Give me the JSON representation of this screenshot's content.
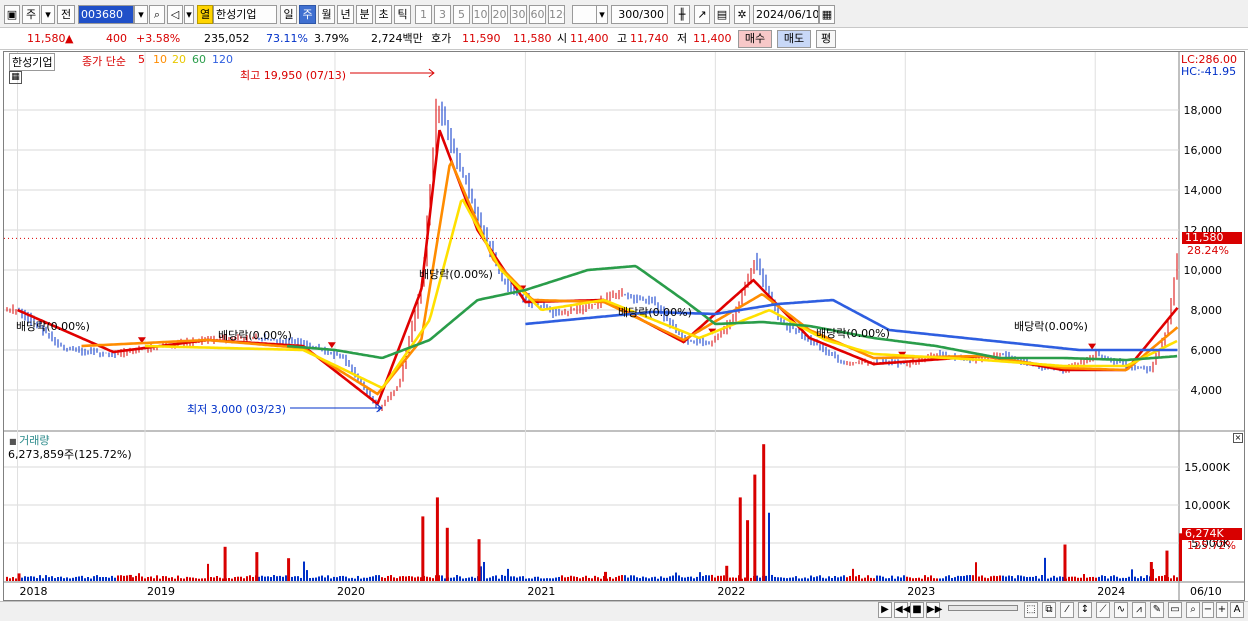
{
  "toolbar": {
    "market_label": "주",
    "prev_label": "전",
    "code": "003680",
    "open_label": "열",
    "name": "한성기업",
    "periods": [
      "일",
      "주",
      "월",
      "년",
      "분",
      "초",
      "틱"
    ],
    "minutes": [
      "1",
      "3",
      "5",
      "10",
      "20",
      "30",
      "60",
      "120"
    ],
    "count": "300/300",
    "date": "2024/06/10"
  },
  "quote": {
    "price": "11,580",
    "arrow": "▲",
    "change": "400",
    "change_pct": "+3.58%",
    "volume": "235,052",
    "vol_ratio": "73.11%",
    "turnover": "3.79%",
    "amount": "2,724백만",
    "ask_label": "호가",
    "ask": "11,590",
    "bid": "11,580",
    "open_label": "시",
    "open": "11,400",
    "high_label": "고",
    "high": "11,740",
    "low_label": "저",
    "low": "11,400",
    "buy_label": "매수",
    "sell_label": "매도",
    "eval_label": "평"
  },
  "legend": {
    "name": "한성기업",
    "close_simple": "종가 단순",
    "ma5": "5",
    "ma10": "10",
    "ma20": "20",
    "ma60": "60",
    "ma120": "120"
  },
  "price_axis": {
    "lc": "LC:286.00",
    "hc": "HC:-41.95",
    "current_badge": "11,580",
    "current_pct": "28.24%"
  },
  "annotations": {
    "high": "최고 19,950 (07/13)",
    "low": "최저 3,000 (03/23)",
    "dividend": "배당락(0.00%)"
  },
  "volume_panel": {
    "title": "거래량",
    "value": "6,273,859주(125.72%)",
    "badge": "6,274K",
    "badge_pct": "125.72%"
  },
  "x_axis_end": "06/10",
  "colors": {
    "up": "#d80000",
    "down": "#0030c8",
    "ma5": "#e00000",
    "ma10": "#ff8c00",
    "ma20": "#ffe000",
    "ma60": "#2a9d4a",
    "ma120": "#2e5ee0"
  },
  "chart_data": {
    "type": "line",
    "title": "",
    "price_ticks": [
      4000,
      6000,
      8000,
      10000,
      12000,
      14000,
      16000,
      18000
    ],
    "price_tick_labels": [
      "4,000",
      "6,000",
      "8,000",
      "10,000",
      "12,000",
      "14,000",
      "16,000",
      "18,000"
    ],
    "volume_ticks": [
      5000,
      10000,
      15000
    ],
    "volume_tick_labels": [
      "5,000K",
      "10,000K",
      "15,000K"
    ],
    "x_labels": [
      "2018",
      "2019",
      "2020",
      "2021",
      "2022",
      "2023",
      "2024"
    ],
    "x_label_dates": [
      "2018-05-01",
      "2019-01-01",
      "2020-01-01",
      "2021-01-01",
      "2022-01-01",
      "2023-01-01",
      "2024-01-01"
    ],
    "dividend_dates": [
      "2018-12-26",
      "2019-12-26",
      "2020-12-26",
      "2021-12-26",
      "2022-12-26",
      "2023-12-26"
    ],
    "close_series": {
      "dates": [
        "2018-05-01",
        "2018-08-01",
        "2018-11-01",
        "2019-02-01",
        "2019-05-01",
        "2019-08-01",
        "2019-11-01",
        "2020-01-15",
        "2020-03-23",
        "2020-05-01",
        "2020-06-15",
        "2020-07-13",
        "2020-08-15",
        "2020-10-01",
        "2020-11-15",
        "2021-01-01",
        "2021-03-01",
        "2021-05-01",
        "2021-07-01",
        "2021-09-01",
        "2021-11-01",
        "2021-12-20",
        "2022-02-01",
        "2022-03-15",
        "2022-05-01",
        "2022-07-01",
        "2022-09-01",
        "2022-11-01",
        "2023-01-01",
        "2023-03-01",
        "2023-05-01",
        "2023-07-01",
        "2023-09-01",
        "2023-11-01",
        "2024-01-01",
        "2024-03-01",
        "2024-04-15",
        "2024-05-15",
        "2024-06-10"
      ],
      "values": [
        8000,
        6000,
        5800,
        6200,
        6500,
        6600,
        6300,
        5600,
        3000,
        4300,
        9500,
        18500,
        16000,
        12500,
        9500,
        8500,
        7800,
        8200,
        8800,
        8400,
        6500,
        6300,
        7500,
        10500,
        7500,
        6500,
        5300,
        5400,
        5300,
        5800,
        5500,
        5800,
        5200,
        5000,
        5800,
        5200,
        5000,
        7000,
        11580
      ]
    },
    "ma_series": [
      {
        "name": "5",
        "color": "#e00000",
        "dates": [
          "2018-05-01",
          "2018-11-01",
          "2019-05-01",
          "2019-11-01",
          "2020-03-23",
          "2020-06-15",
          "2020-07-20",
          "2020-10-01",
          "2021-01-01",
          "2021-06-01",
          "2021-11-01",
          "2022-03-15",
          "2022-07-01",
          "2022-11-01",
          "2023-06-01",
          "2023-11-01",
          "2024-03-01",
          "2024-06-10"
        ],
        "values": [
          8000,
          5900,
          6500,
          6200,
          3300,
          9000,
          17000,
          12000,
          8400,
          8500,
          6400,
          9500,
          6600,
          5300,
          5700,
          5000,
          5000,
          8200
        ]
      },
      {
        "name": "10",
        "color": "#ff8c00",
        "dates": [
          "2018-09-01",
          "2019-05-01",
          "2019-11-01",
          "2020-03-23",
          "2020-06-15",
          "2020-08-10",
          "2020-11-01",
          "2021-01-15",
          "2021-06-01",
          "2021-11-01",
          "2022-04-01",
          "2022-07-01",
          "2022-11-01",
          "2023-06-01",
          "2023-11-01",
          "2024-03-01",
          "2024-06-10"
        ],
        "values": [
          6200,
          6500,
          6100,
          3800,
          6500,
          15500,
          10500,
          8500,
          8400,
          6500,
          8800,
          7000,
          5600,
          5700,
          5100,
          5000,
          7200
        ]
      },
      {
        "name": "20",
        "color": "#ffe000",
        "dates": [
          "2019-01-01",
          "2019-11-01",
          "2020-04-01",
          "2020-07-01",
          "2020-09-01",
          "2020-11-15",
          "2021-02-01",
          "2021-06-01",
          "2021-12-01",
          "2022-04-15",
          "2022-08-01",
          "2022-11-01",
          "2023-06-01",
          "2023-11-01",
          "2024-03-01",
          "2024-06-10"
        ],
        "values": [
          6200,
          6000,
          4100,
          7500,
          13600,
          10000,
          8000,
          8500,
          6600,
          8000,
          6500,
          5800,
          5500,
          5200,
          5200,
          6500
        ]
      },
      {
        "name": "60",
        "color": "#2a9d4a",
        "dates": [
          "2019-10-01",
          "2020-01-01",
          "2020-04-01",
          "2020-07-01",
          "2020-10-01",
          "2021-01-01",
          "2021-05-01",
          "2021-08-01",
          "2021-11-01",
          "2022-01-01",
          "2022-04-01",
          "2022-07-01",
          "2022-11-01",
          "2023-03-01",
          "2023-07-01",
          "2023-11-01",
          "2024-03-01",
          "2024-06-10"
        ],
        "values": [
          6200,
          6000,
          5600,
          6500,
          8500,
          9000,
          10000,
          10200,
          8500,
          7300,
          7400,
          7200,
          6600,
          6200,
          5600,
          5600,
          5500,
          5700
        ]
      },
      {
        "name": "120",
        "color": "#2e5ee0",
        "dates": [
          "2021-01-01",
          "2021-05-01",
          "2021-09-01",
          "2022-01-01",
          "2022-05-01",
          "2022-08-15",
          "2022-12-01",
          "2023-06-01",
          "2023-12-01",
          "2024-06-10"
        ],
        "values": [
          7300,
          7600,
          7900,
          7800,
          8300,
          8500,
          7000,
          6500,
          6000,
          6000
        ]
      }
    ],
    "volume": {
      "dates": [
        "2018-05-01",
        "2018-12-01",
        "2019-06-01",
        "2019-08-01",
        "2019-10-01",
        "2020-06-15",
        "2020-07-13",
        "2020-08-01",
        "2020-10-01",
        "2021-06-01",
        "2022-01-20",
        "2022-02-15",
        "2022-03-01",
        "2022-03-15",
        "2022-04-01",
        "2023-11-01",
        "2024-04-15",
        "2024-05-15",
        "2024-06-10"
      ],
      "values_k": [
        1000,
        800,
        4500,
        3800,
        3000,
        8500,
        11000,
        7000,
        5500,
        1200,
        2000,
        11000,
        8000,
        14000,
        18000,
        4800,
        2500,
        4000,
        6274
      ]
    }
  }
}
